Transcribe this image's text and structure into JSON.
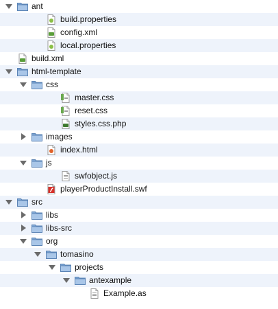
{
  "tree": {
    "rows": [
      {
        "name": "ant",
        "type": "folder",
        "level": 0,
        "expanded": true
      },
      {
        "name": "build.properties",
        "type": "props",
        "level": 2
      },
      {
        "name": "config.xml",
        "type": "xml",
        "level": 2
      },
      {
        "name": "local.properties",
        "type": "props",
        "level": 2
      },
      {
        "name": "build.xml",
        "type": "xml",
        "level": 0
      },
      {
        "name": "html-template",
        "type": "folder",
        "level": 0,
        "expanded": true
      },
      {
        "name": "css",
        "type": "folder",
        "level": 1,
        "expanded": true
      },
      {
        "name": "master.css",
        "type": "css",
        "level": 3
      },
      {
        "name": "reset.css",
        "type": "css",
        "level": 3
      },
      {
        "name": "styles.css.php",
        "type": "php",
        "level": 3
      },
      {
        "name": "images",
        "type": "folder",
        "level": 1,
        "expanded": false
      },
      {
        "name": "index.html",
        "type": "html",
        "level": 2
      },
      {
        "name": "js",
        "type": "folder",
        "level": 1,
        "expanded": true
      },
      {
        "name": "swfobject.js",
        "type": "js",
        "level": 3
      },
      {
        "name": "playerProductInstall.swf",
        "type": "swf",
        "level": 2
      },
      {
        "name": "src",
        "type": "folder",
        "level": 0,
        "expanded": true
      },
      {
        "name": "libs",
        "type": "folder",
        "level": 1,
        "expanded": false
      },
      {
        "name": "libs-src",
        "type": "folder",
        "level": 1,
        "expanded": false
      },
      {
        "name": "org",
        "type": "folder",
        "level": 1,
        "expanded": true
      },
      {
        "name": "tomasino",
        "type": "folder",
        "level": 2,
        "expanded": true
      },
      {
        "name": "projects",
        "type": "folder",
        "level": 3,
        "expanded": true
      },
      {
        "name": "antexample",
        "type": "folder",
        "level": 4,
        "expanded": true
      },
      {
        "name": "Example.as",
        "type": "as",
        "level": 5
      }
    ]
  },
  "colors": {
    "stripe": "#eef3fb",
    "folder": "#8fb3dc",
    "triangle": "#6b6b6b"
  }
}
